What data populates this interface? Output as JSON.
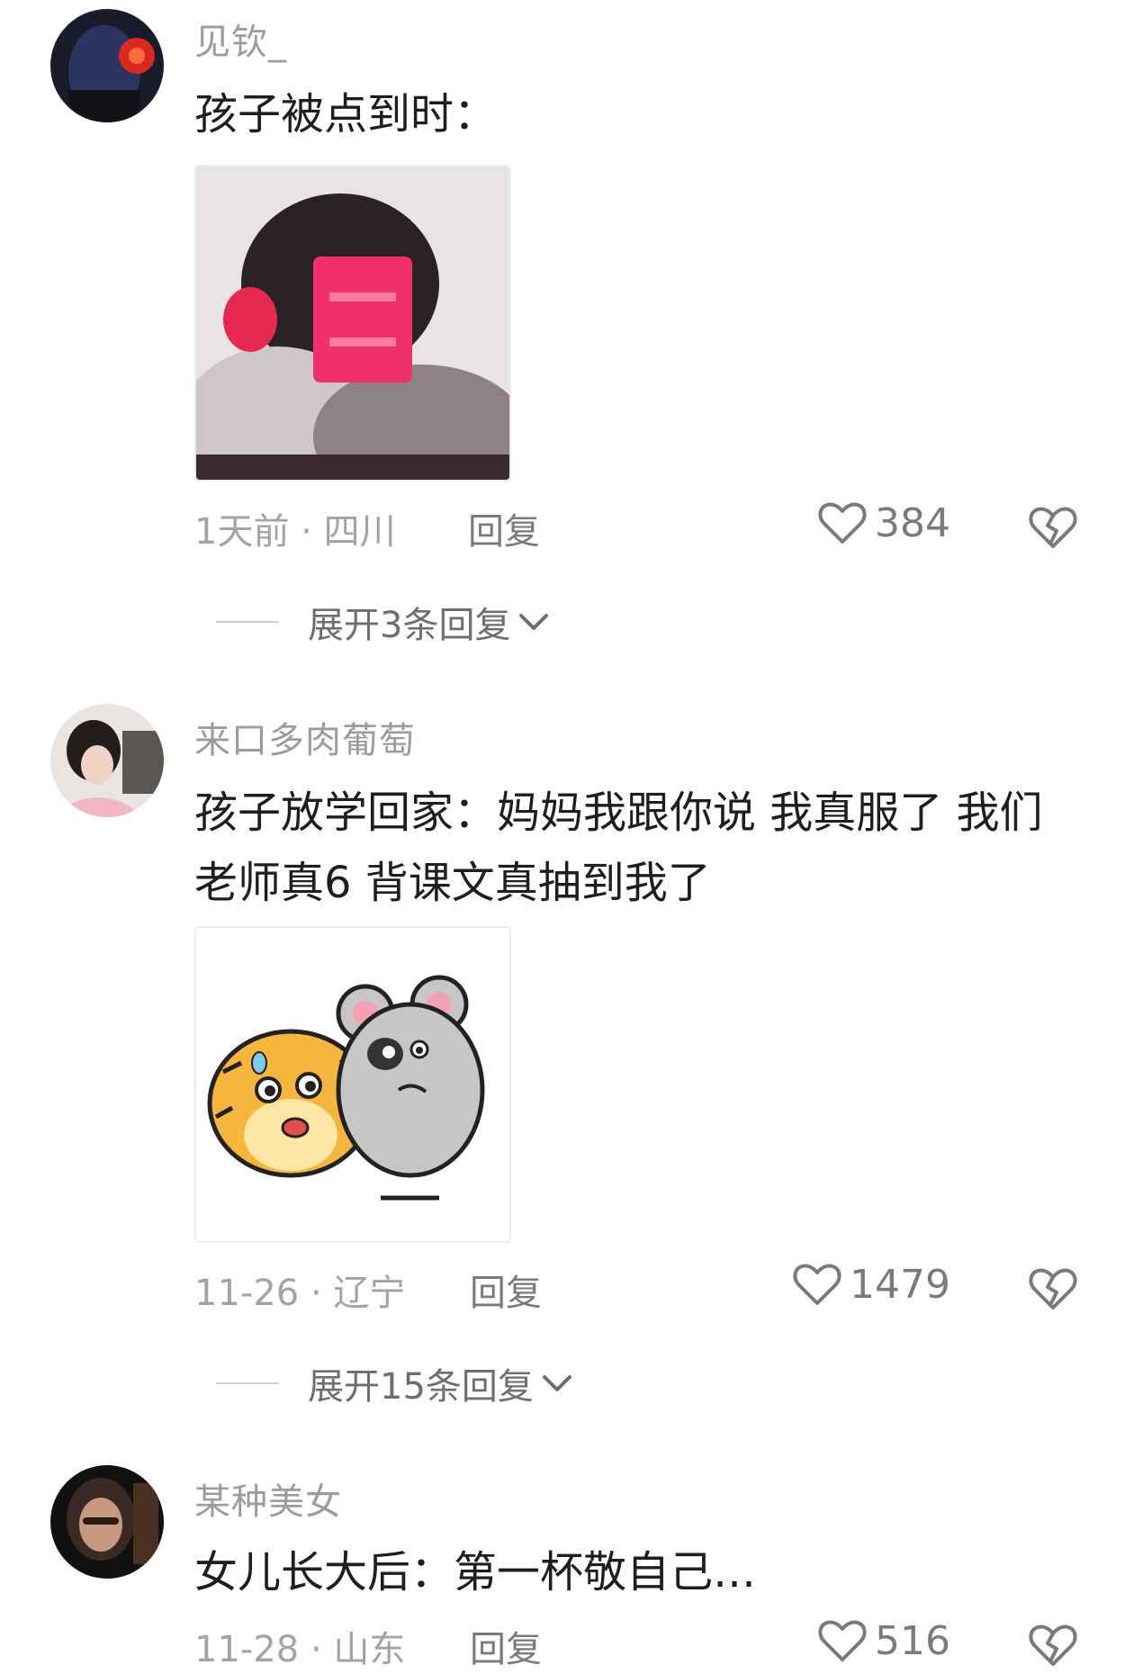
{
  "comments": [
    {
      "username": "见钦_",
      "text": "孩子被点到时：",
      "meta": "1天前 · 四川",
      "reply_label": "回复",
      "likes": "384",
      "expand": "展开3条回复"
    },
    {
      "username": "来口多肉葡萄",
      "text": "孩子放学回家：妈妈我跟你说 我真服了 我们老师真6 背课文真抽到我了",
      "meta": "11-26 · 辽宁",
      "reply_label": "回复",
      "likes": "1479",
      "expand": "展开15条回复"
    },
    {
      "username": "某种美女",
      "text": "女儿长大后：第一杯敬自己…",
      "meta": "11-28 · 山东",
      "reply_label": "回复",
      "likes": "516"
    }
  ],
  "icons": {
    "like": "heart-outline-icon",
    "dislike": "broken-heart-icon",
    "expand": "chevron-down-icon"
  },
  "colors": {
    "username": "#9c9c9c",
    "text": "#1e1e1e",
    "meta": "#a3a3a3",
    "icon": "#7a7a7a"
  }
}
